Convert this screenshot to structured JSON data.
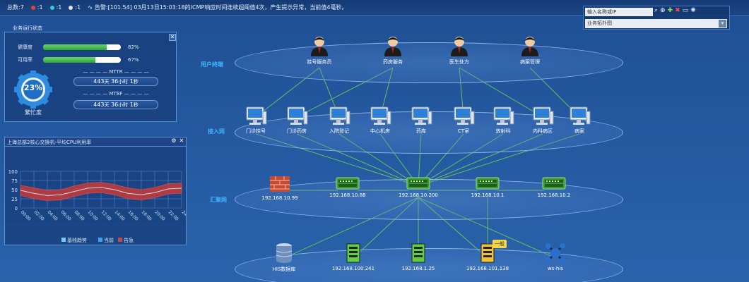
{
  "topbar": {
    "total": "总数:7",
    "c1": ":1",
    "c2": ":1",
    "c3": ":1",
    "alert": "告警:[101.54] 03月13日15:03:18的ICMP响应时间连续超阈值4次，产生提示异常，当前值4毫秒。"
  },
  "search": {
    "placeholder": "输入名称或IP",
    "select_value": "业务拓扑图",
    "icons": [
      "search-icon",
      "zoom-in-icon",
      "add-icon",
      "delete-icon",
      "message-icon",
      "settings-icon"
    ]
  },
  "status_panel": {
    "title": "业务运行状态",
    "health_label": "健康度",
    "health_value": "82%",
    "health_fraction": 0.82,
    "avail_label": "可用率",
    "avail_value": "67%",
    "avail_fraction": 0.67,
    "gauge_value": "23%",
    "gauge_label": "繁忙度",
    "mttr_label": "MTTR",
    "mttr_days": "443",
    "mttr_hours": "36",
    "mttr_minutes": "1",
    "mtbf_label": "MTBF",
    "mtbf_days": "443",
    "mtbf_hours": "36",
    "mtbf_minutes": "1",
    "unit_day": "天",
    "unit_hour": "小时",
    "unit_min": "秒"
  },
  "chart_panel": {
    "title": "上海总部2核心交换机-平均CPU利用率"
  },
  "chart_data": {
    "type": "area",
    "title": "上海总部2核心交换机-平均CPU利用率",
    "x": [
      "00:00",
      "02:00",
      "04:00",
      "06:00",
      "08:00",
      "10:00",
      "12:00",
      "14:00",
      "16:00",
      "18:00",
      "20:00",
      "22:00",
      "24:00"
    ],
    "ylim": [
      0,
      100
    ],
    "yticks": [
      0,
      25,
      50,
      75,
      100
    ],
    "series": [
      {
        "name": "基线趋势",
        "values": [
          48,
          40,
          34,
          36,
          45,
          54,
          56,
          50,
          40,
          36,
          42,
          52,
          54
        ]
      },
      {
        "name": "当前",
        "values": [
          48,
          40,
          34,
          36,
          45,
          54,
          56,
          50,
          40,
          36,
          42,
          52,
          54
        ]
      },
      {
        "name": "告急",
        "upper": [
          62,
          55,
          48,
          50,
          60,
          68,
          70,
          64,
          55,
          50,
          56,
          66,
          68
        ],
        "lower": [
          34,
          25,
          20,
          22,
          31,
          40,
          42,
          36,
          25,
          22,
          28,
          38,
          40
        ]
      }
    ],
    "legend": [
      "基线趋势",
      "当前",
      "告急"
    ],
    "colors": {
      "band": "#c83a3a",
      "line": "#d9d9d9",
      "legend1": "#7ec8f0",
      "legend2": "#3fa0e6",
      "legend3": "#c84a3a"
    },
    "grid": true
  },
  "lanes": {
    "user": "用户终端",
    "access": "接入网",
    "aggregate": "汇聚网"
  },
  "users": [
    "挂号服务员",
    "药房服务",
    "医生处方",
    "病案管理"
  ],
  "access_nodes": [
    "门诊挂号",
    "门诊药房",
    "入院登记",
    "中心机房",
    "药库",
    "CT室",
    "放射科",
    "内科病区",
    "病案"
  ],
  "agg_nodes": [
    "192.168.10.99",
    "192.168.10.88",
    "192.168.10.200",
    "192.168.10.1",
    "192.168.10.2"
  ],
  "core_nodes": [
    "HIS数据库",
    "192.168.100.241",
    "192.168.1.25",
    "192.168.101.138",
    "ws-his"
  ],
  "badge": "一般"
}
